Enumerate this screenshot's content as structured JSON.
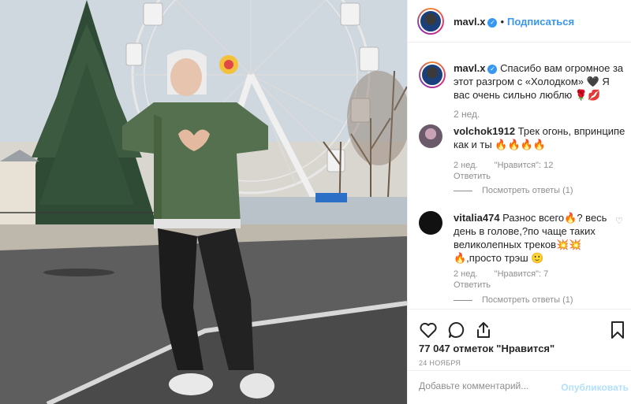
{
  "header": {
    "username": "mavl.x",
    "separator": "•",
    "follow_label": "Подписаться"
  },
  "caption": {
    "username": "mavl.x",
    "text": "Спасибо вам огромное за этот разгром с «Холодком» 🖤 Я вас очень сильно люблю 🌹💋",
    "time": "2 нед."
  },
  "comments": [
    {
      "username": "volchok1912",
      "text": "Трек огонь, впринципе как и ты 🔥🔥🔥🔥",
      "time": "2 нед.",
      "likes": "\"Нравится\": 12",
      "reply": "Ответить",
      "view_replies": "Посмотреть ответы (1)"
    },
    {
      "username": "vitalia474",
      "text": "Разнос всего🔥? весь день в голове,?по чаще таких великолепных треков💥💥 🔥,просто трэш 🙂",
      "time": "2 нед.",
      "likes": "\"Нравится\": 7",
      "reply": "Ответить",
      "view_replies": "Посмотреть ответы (1)"
    }
  ],
  "post": {
    "likes": "77 047 отметок \"Нравится\"",
    "date": "24 НОЯБРЯ"
  },
  "add_comment": {
    "placeholder": "Добавьте комментарий...",
    "publish_label": "Опубликовать"
  },
  "colors": {
    "accent": "#3897f0",
    "publish_disabled": "#b2dffc",
    "meta_text": "#8e8e8e"
  },
  "icons": [
    "heart-icon",
    "comment-icon",
    "share-icon",
    "bookmark-icon",
    "verified-icon"
  ]
}
